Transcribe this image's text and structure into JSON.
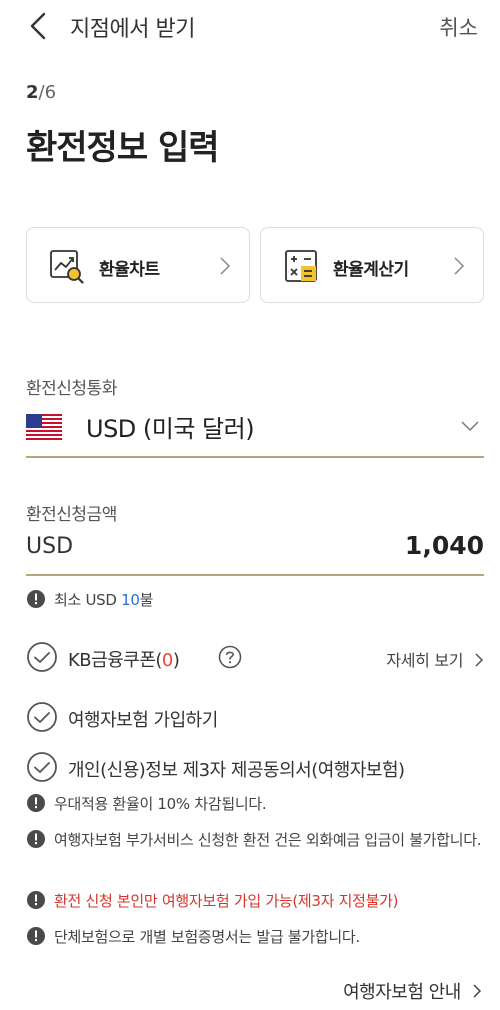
{
  "header": {
    "title": "지점에서 받기",
    "cancel_label": "취소"
  },
  "step": {
    "current": "2",
    "separator": "/",
    "total": "6"
  },
  "page_title": "환전정보 입력",
  "tools": {
    "chart_label": "환율차트",
    "calculator_label": "환율계산기"
  },
  "currency": {
    "label": "환전신청통화",
    "value": "USD (미국 달러)"
  },
  "amount": {
    "label": "환전신청금액",
    "currency": "USD",
    "value": "1,040"
  },
  "min_info": {
    "prefix": "최소 USD ",
    "amount": "10",
    "suffix": "불"
  },
  "checks": {
    "coupon_prefix": "KB금융쿠폰(",
    "coupon_count": "0",
    "coupon_suffix": ")",
    "detail_label": "자세히 보기",
    "insurance_label": "여행자보험 가입하기",
    "consent_label": "개인(신용)정보 제3자 제공동의서(여행자보험)"
  },
  "notices": {
    "rate": "우대적용 환율이 10% 차감됩니다.",
    "deposit": "여행자보험 부가서비스 신청한 환전 건은 외화예금 입금이 불가합니다.",
    "self_only": "환전 신청 본인만 여행자보험 가입 가능(제3자 지정불가)",
    "certificate": "단체보험으로 개별 보험증명서는 발급 불가합니다."
  },
  "guide_link": "여행자보험 안내",
  "colors": {
    "underline": "#b8a37a",
    "blue": "#2a6dd8",
    "red": "#d6352e",
    "calc_yellow": "#f3c22f"
  }
}
